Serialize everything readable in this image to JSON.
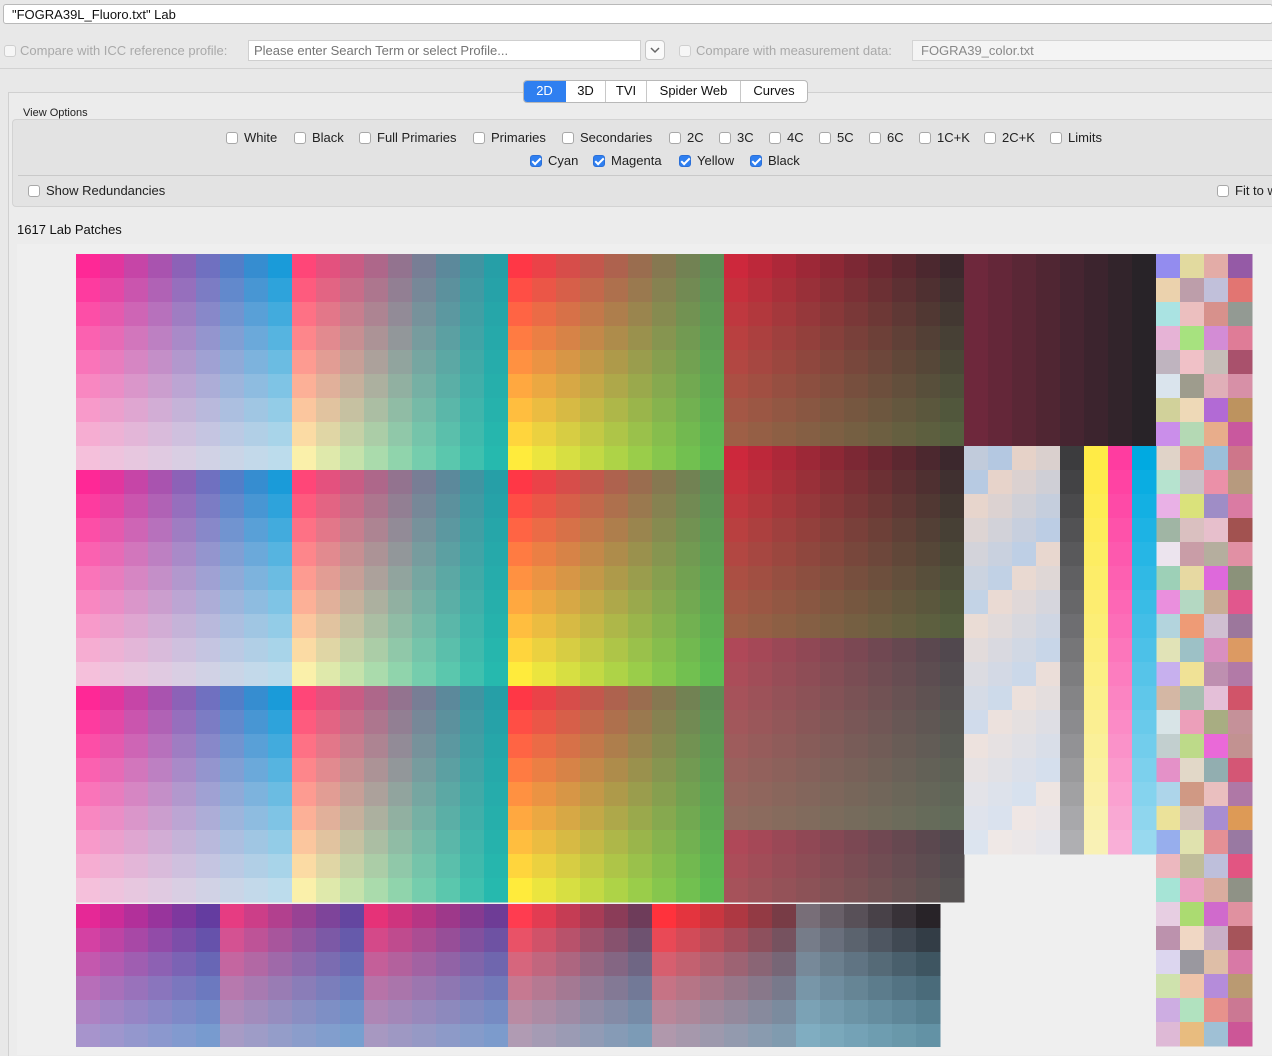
{
  "window": {
    "title": "\"FOGRA39L_Fluoro.txt\" Lab"
  },
  "compare": {
    "icc_label": "Compare with ICC reference profile:",
    "icc_placeholder": "Please enter Search Term or select Profile...",
    "measurement_label": "Compare with measurement data:",
    "measurement_value": "FOGRA39_color.txt"
  },
  "tabs": [
    "2D",
    "3D",
    "TVI",
    "Spider Web",
    "Curves"
  ],
  "active_tab": "2D",
  "view_options": {
    "title": "View Options",
    "row1": [
      {
        "label": "White",
        "checked": false
      },
      {
        "label": "Black",
        "checked": false
      },
      {
        "label": "Full Primaries",
        "checked": false
      },
      {
        "label": "Primaries",
        "checked": false
      },
      {
        "label": "Secondaries",
        "checked": false
      },
      {
        "label": "2C",
        "checked": false
      },
      {
        "label": "3C",
        "checked": false
      },
      {
        "label": "4C",
        "checked": false
      },
      {
        "label": "5C",
        "checked": false
      },
      {
        "label": "6C",
        "checked": false
      },
      {
        "label": "1C+K",
        "checked": false
      },
      {
        "label": "2C+K",
        "checked": false
      },
      {
        "label": "Limits",
        "checked": false
      }
    ],
    "row2": [
      {
        "label": "Cyan",
        "checked": true
      },
      {
        "label": "Magenta",
        "checked": true
      },
      {
        "label": "Yellow",
        "checked": true
      },
      {
        "label": "Black",
        "checked": true
      }
    ],
    "show_redundancies": {
      "label": "Show Redundancies",
      "checked": false
    },
    "fit_to": {
      "label": "Fit to w",
      "checked": false
    }
  },
  "patch_count_label": "1617 Lab Patches",
  "colors": {
    "accent": "#2f7ff0",
    "fluoro_magenta": "#ff2f9a",
    "fluoro_red": "#ff3a4e",
    "cyan": "#00a8e0",
    "yellow": "#ffe94a"
  }
}
